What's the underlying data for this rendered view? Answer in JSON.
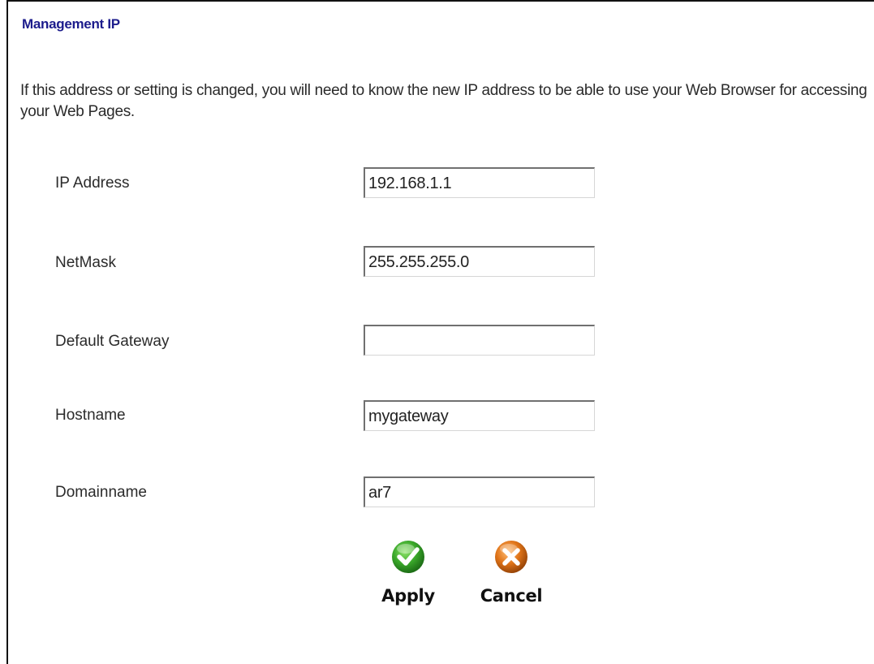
{
  "page": {
    "title": "Management IP",
    "intro": "If this address or setting is changed, you will need to know the new IP address to be able to use your Web Browser for accessing your Web Pages."
  },
  "form": {
    "ip_address": {
      "label": "IP Address",
      "value": "192.168.1.1"
    },
    "netmask": {
      "label": "NetMask",
      "value": "255.255.255.0"
    },
    "default_gateway": {
      "label": "Default Gateway",
      "value": ""
    },
    "hostname": {
      "label": "Hostname",
      "value": "mygateway"
    },
    "domainname": {
      "label": "Domainname",
      "value": "ar7"
    }
  },
  "actions": {
    "apply": {
      "label": "Apply",
      "icon": "checkmark-icon",
      "color": "#3aa82a"
    },
    "cancel": {
      "label": "Cancel",
      "icon": "x-icon",
      "color": "#e07418"
    }
  },
  "colors": {
    "title": "#1c1c8c",
    "text": "#2b2b2b"
  }
}
